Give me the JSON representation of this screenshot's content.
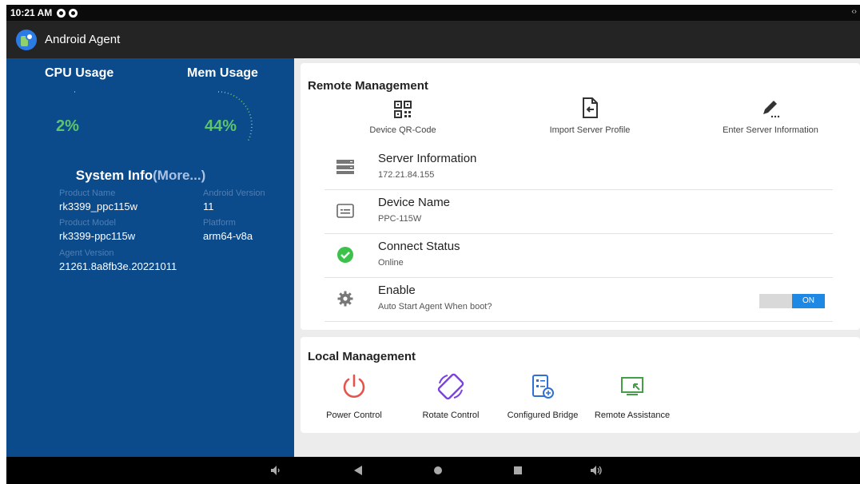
{
  "status_bar": {
    "time": "10:21 AM"
  },
  "app_bar": {
    "title": "Android Agent"
  },
  "left_panel": {
    "cpu": {
      "title": "CPU Usage",
      "value": "2%"
    },
    "mem": {
      "title": "Mem Usage",
      "value": "44%"
    },
    "system_info": {
      "title": "System Info",
      "more": "(More...)",
      "closing": ")",
      "product_name_label": "Product Name",
      "product_name": "rk3399_ppc115w",
      "android_version_label": "Android Version",
      "android_version": "11",
      "product_model_label": "Product Model",
      "product_model": "rk3399-ppc115w",
      "platform_label": "Platform",
      "platform": "arm64-v8a",
      "agent_version_label": "Agent Version",
      "agent_version": "21261.8a8fb3e.20221011"
    }
  },
  "remote_management": {
    "title": "Remote Management",
    "actions": {
      "qr": "Device QR-Code",
      "import": "Import Server Profile",
      "enter": "Enter Server Information"
    },
    "rows": {
      "server": {
        "title": "Server Information",
        "sub": "172.21.84.155"
      },
      "device": {
        "title": "Device Name",
        "sub": "PPC-115W"
      },
      "connect": {
        "title": "Connect Status",
        "sub": "Online"
      },
      "enable": {
        "title": "Enable",
        "sub": "Auto Start Agent When boot?",
        "toggle": "ON"
      }
    }
  },
  "local_management": {
    "title": "Local Management",
    "actions": {
      "power": "Power Control",
      "rotate": "Rotate Control",
      "bridge": "Configured Bridge",
      "assist": "Remote Assistance"
    }
  },
  "colors": {
    "left_panel_bg": "#0b4a8b",
    "gauge_green": "#5ec46b",
    "toggle_blue": "#1e88e5",
    "power_red": "#e5534b",
    "rotate_purple": "#7b3fe4",
    "bridge_blue": "#2f6fd6",
    "assist_green": "#43a047"
  },
  "icons": {
    "qr": "qr-code-icon",
    "import": "import-file-icon",
    "enter": "pen-edit-icon",
    "server": "server-icon",
    "device": "id-card-icon",
    "connect": "check-circle-icon",
    "enable": "gear-icon",
    "power": "power-icon",
    "rotate": "rotate-icon",
    "bridge": "bridge-config-icon",
    "assist": "remote-screen-icon"
  },
  "gauges": {
    "cpu_percent": 2,
    "mem_percent": 44
  }
}
